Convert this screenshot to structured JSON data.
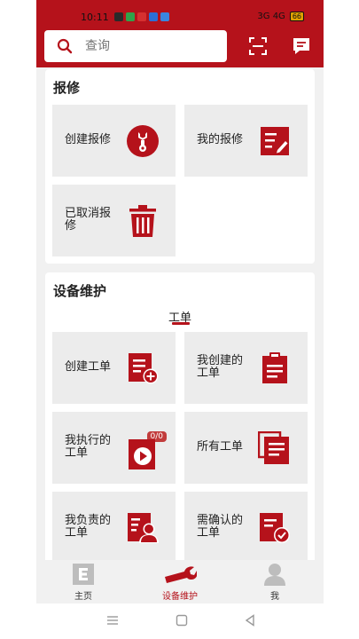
{
  "status_bar": {
    "time": "10:11",
    "signal_text": "3G 4G",
    "battery": "66"
  },
  "search": {
    "placeholder": "查询"
  },
  "repair_section": {
    "title": "报修",
    "tiles": [
      {
        "label": "创建报修",
        "icon": "wrench-circle-icon"
      },
      {
        "label": "我的报修",
        "icon": "edit-list-icon"
      },
      {
        "label": "已取消报修",
        "icon": "trash-icon"
      }
    ]
  },
  "maintenance_section": {
    "title": "设备维护",
    "tab": "工单",
    "tiles": [
      {
        "label": "创建工单",
        "icon": "add-document-icon"
      },
      {
        "label": "我创建的工单",
        "icon": "clipboard-icon"
      },
      {
        "label": "我执行的工单",
        "icon": "play-document-icon",
        "badge": "0/0"
      },
      {
        "label": "所有工单",
        "icon": "stacked-documents-icon"
      },
      {
        "label": "我负责的工单",
        "icon": "person-document-icon"
      },
      {
        "label": "需确认的工单",
        "icon": "check-document-icon"
      }
    ]
  },
  "bottom_nav": [
    {
      "label": "主页",
      "icon": "home-e-icon",
      "active": false
    },
    {
      "label": "设备维护",
      "icon": "wrench-icon",
      "active": true
    },
    {
      "label": "我",
      "icon": "person-icon",
      "active": false
    }
  ],
  "colors": {
    "brand": "#b5121b",
    "tile_bg": "#ececec",
    "page_bg": "#f1f1f1"
  }
}
